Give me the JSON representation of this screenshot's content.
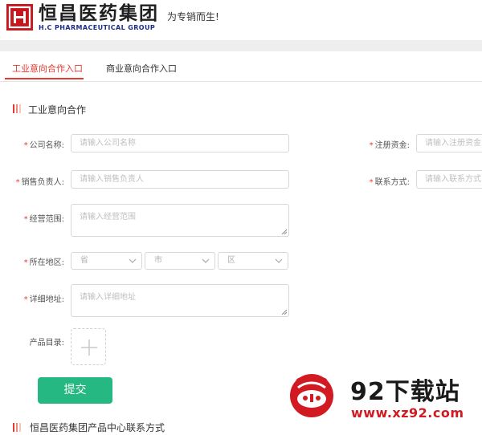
{
  "header": {
    "brand_name": "恒昌医药集团",
    "brand_sub": "H.C PHARMACEUTICAL GROUP",
    "slogan": "为专销而生!",
    "brand_color": "#c8161e"
  },
  "tabs": [
    {
      "label": "工业意向合作入口",
      "active": true
    },
    {
      "label": "商业意向合作入口",
      "active": false
    }
  ],
  "section_title": "工业意向合作",
  "form": {
    "company_name": {
      "label": "公司名称:",
      "required": true,
      "placeholder": "请输入公司名称"
    },
    "registered_capital": {
      "label": "注册资金:",
      "required": true,
      "placeholder": "请输入注册资金"
    },
    "sales_person": {
      "label": "销售负责人:",
      "required": true,
      "placeholder": "请输入销售负责人"
    },
    "contact": {
      "label": "联系方式:",
      "required": true,
      "placeholder": "请输入联系方式"
    },
    "business_scope": {
      "label": "经营范围:",
      "required": true,
      "placeholder": "请输入经营范围"
    },
    "region": {
      "label": "所在地区:",
      "required": true,
      "province": "省",
      "city": "市",
      "district": "区"
    },
    "address": {
      "label": "详细地址:",
      "required": true,
      "placeholder": "请输入详细地址"
    },
    "catalog": {
      "label": "产品目录:",
      "required": false
    },
    "submit_label": "提交",
    "required_mark": "*",
    "accent_color": "#26b883"
  },
  "footer_section_title": "恒昌医药集团产品中心联系方式",
  "watermark": {
    "name": "92下载站",
    "url": "www.xz92.com"
  }
}
